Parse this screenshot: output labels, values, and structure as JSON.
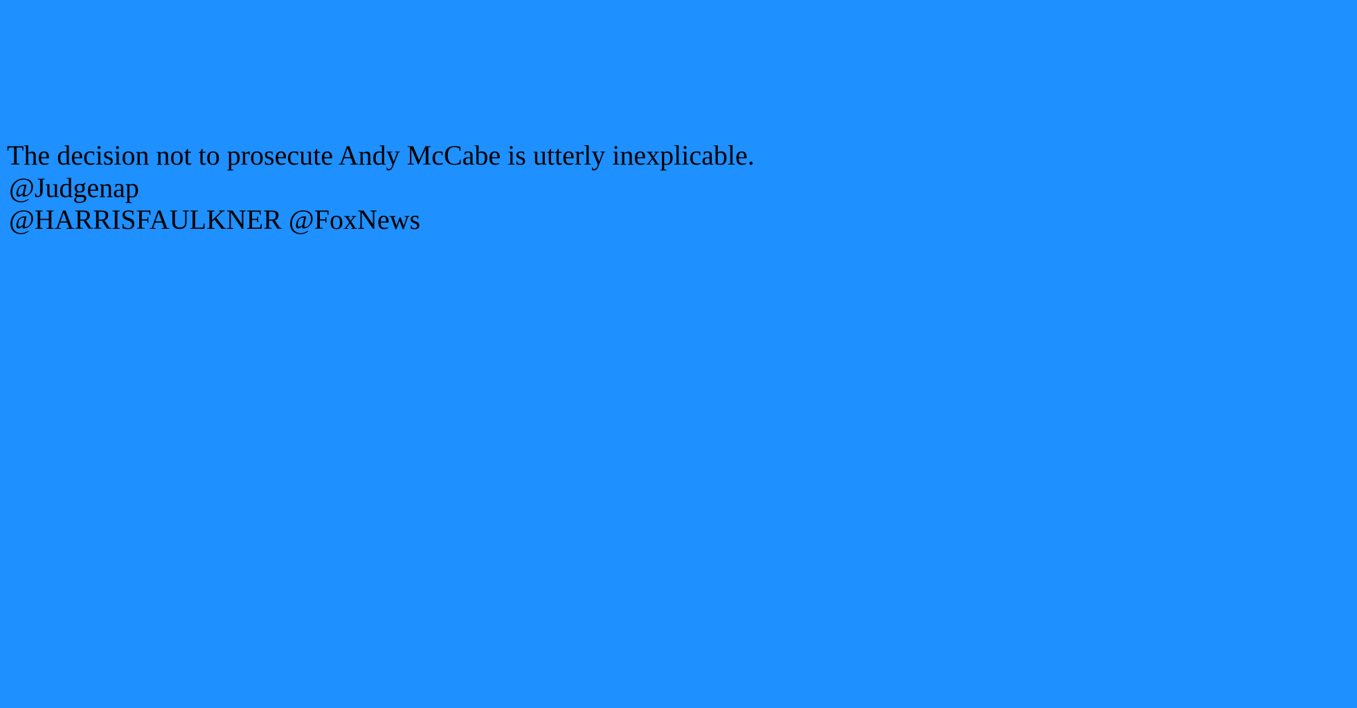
{
  "background_color": "#1e90ff",
  "text_color": "#000000",
  "post": {
    "line_1": "The decision not to prosecute Andy McCabe is utterly inexplicable.",
    "line_2": "@Judgenap",
    "line_3": "@HARRISFAULKNER @FoxNews"
  }
}
